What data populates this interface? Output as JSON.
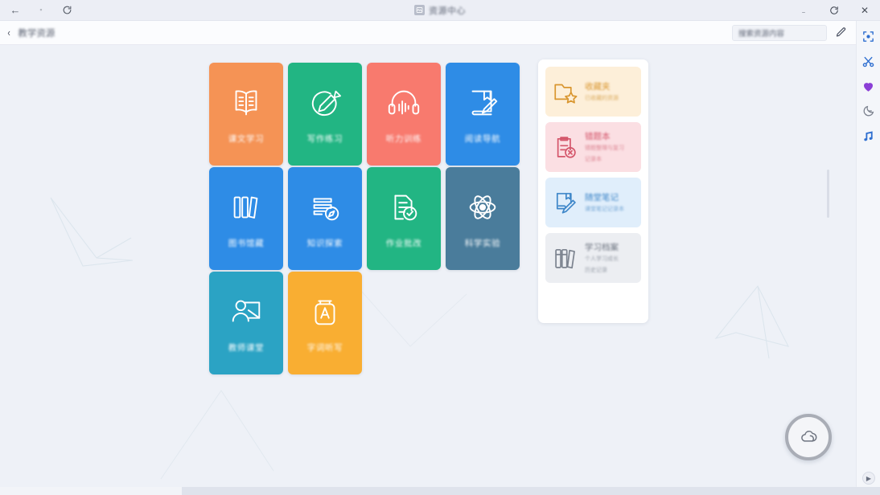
{
  "window": {
    "title": "资源中心",
    "controls": {
      "minimize": "—",
      "restore": "refresh-icon",
      "close": "✕"
    },
    "nav": {
      "back": "←",
      "forward": "→",
      "reload": "reload-icon"
    }
  },
  "subheader": {
    "back_chevron": "‹",
    "breadcrumb": "教学资源",
    "search_value": "搜索资源内容",
    "edit_icon": "pencil-icon"
  },
  "rail": {
    "items": [
      {
        "name": "crop-icon",
        "color": "#2f6fd0"
      },
      {
        "name": "scissors-icon",
        "color": "#2f6fd0"
      },
      {
        "name": "heart-icon",
        "color": "#8b3fd6"
      },
      {
        "name": "moon-icon",
        "color": "#6b7282"
      },
      {
        "name": "music-icon",
        "color": "#2f6fd0"
      }
    ]
  },
  "tiles": [
    {
      "label": "课文学习",
      "icon": "open-book-icon",
      "color": "#f59355"
    },
    {
      "label": "写作练习",
      "icon": "circle-pencil-icon",
      "color": "#22b583"
    },
    {
      "label": "听力训练",
      "icon": "headphones-icon",
      "color": "#f87a6e"
    },
    {
      "label": "阅读导航",
      "icon": "book-pen-icon",
      "color": "#2e8ce6"
    },
    {
      "label": "图书馆藏",
      "icon": "bookshelf-icon",
      "color": "#2e8ce6"
    },
    {
      "label": "知识探索",
      "icon": "books-compass-icon",
      "color": "#2e8ce6"
    },
    {
      "label": "作业批改",
      "icon": "doc-check-icon",
      "color": "#22b583"
    },
    {
      "label": "科学实验",
      "icon": "atom-icon",
      "color": "#4a7c9b"
    },
    {
      "label": "教师课堂",
      "icon": "presenter-icon",
      "color": "#2ba3c4"
    },
    {
      "label": "字词听写",
      "icon": "letter-jar-icon",
      "color": "#f9ae32"
    }
  ],
  "panel": {
    "cards": [
      {
        "title": "收藏夹",
        "subtitle": "已收藏的资源",
        "icon": "folder-star-icon",
        "bg": "#fdefd9",
        "fg": "#d9962f"
      },
      {
        "title": "错题本",
        "subtitle": "错题整理与复习",
        "subtitle2": "记录本",
        "icon": "clipboard-x-icon",
        "bg": "#fbdfe3",
        "fg": "#d4566b"
      },
      {
        "title": "随堂笔记",
        "subtitle": "课堂笔记记录本",
        "icon": "book-pencil-icon",
        "bg": "#e0eefb",
        "fg": "#3f87c9"
      },
      {
        "title": "学习档案",
        "subtitle": "个人学习成长",
        "subtitle2": "历史记录",
        "icon": "books-icon",
        "bg": "#eceef2",
        "fg": "#7c838f"
      }
    ]
  },
  "fab": {
    "icon": "cloud-icon",
    "ring_color": "#a9adb6"
  },
  "bottom": {
    "play_icon": "▶"
  }
}
